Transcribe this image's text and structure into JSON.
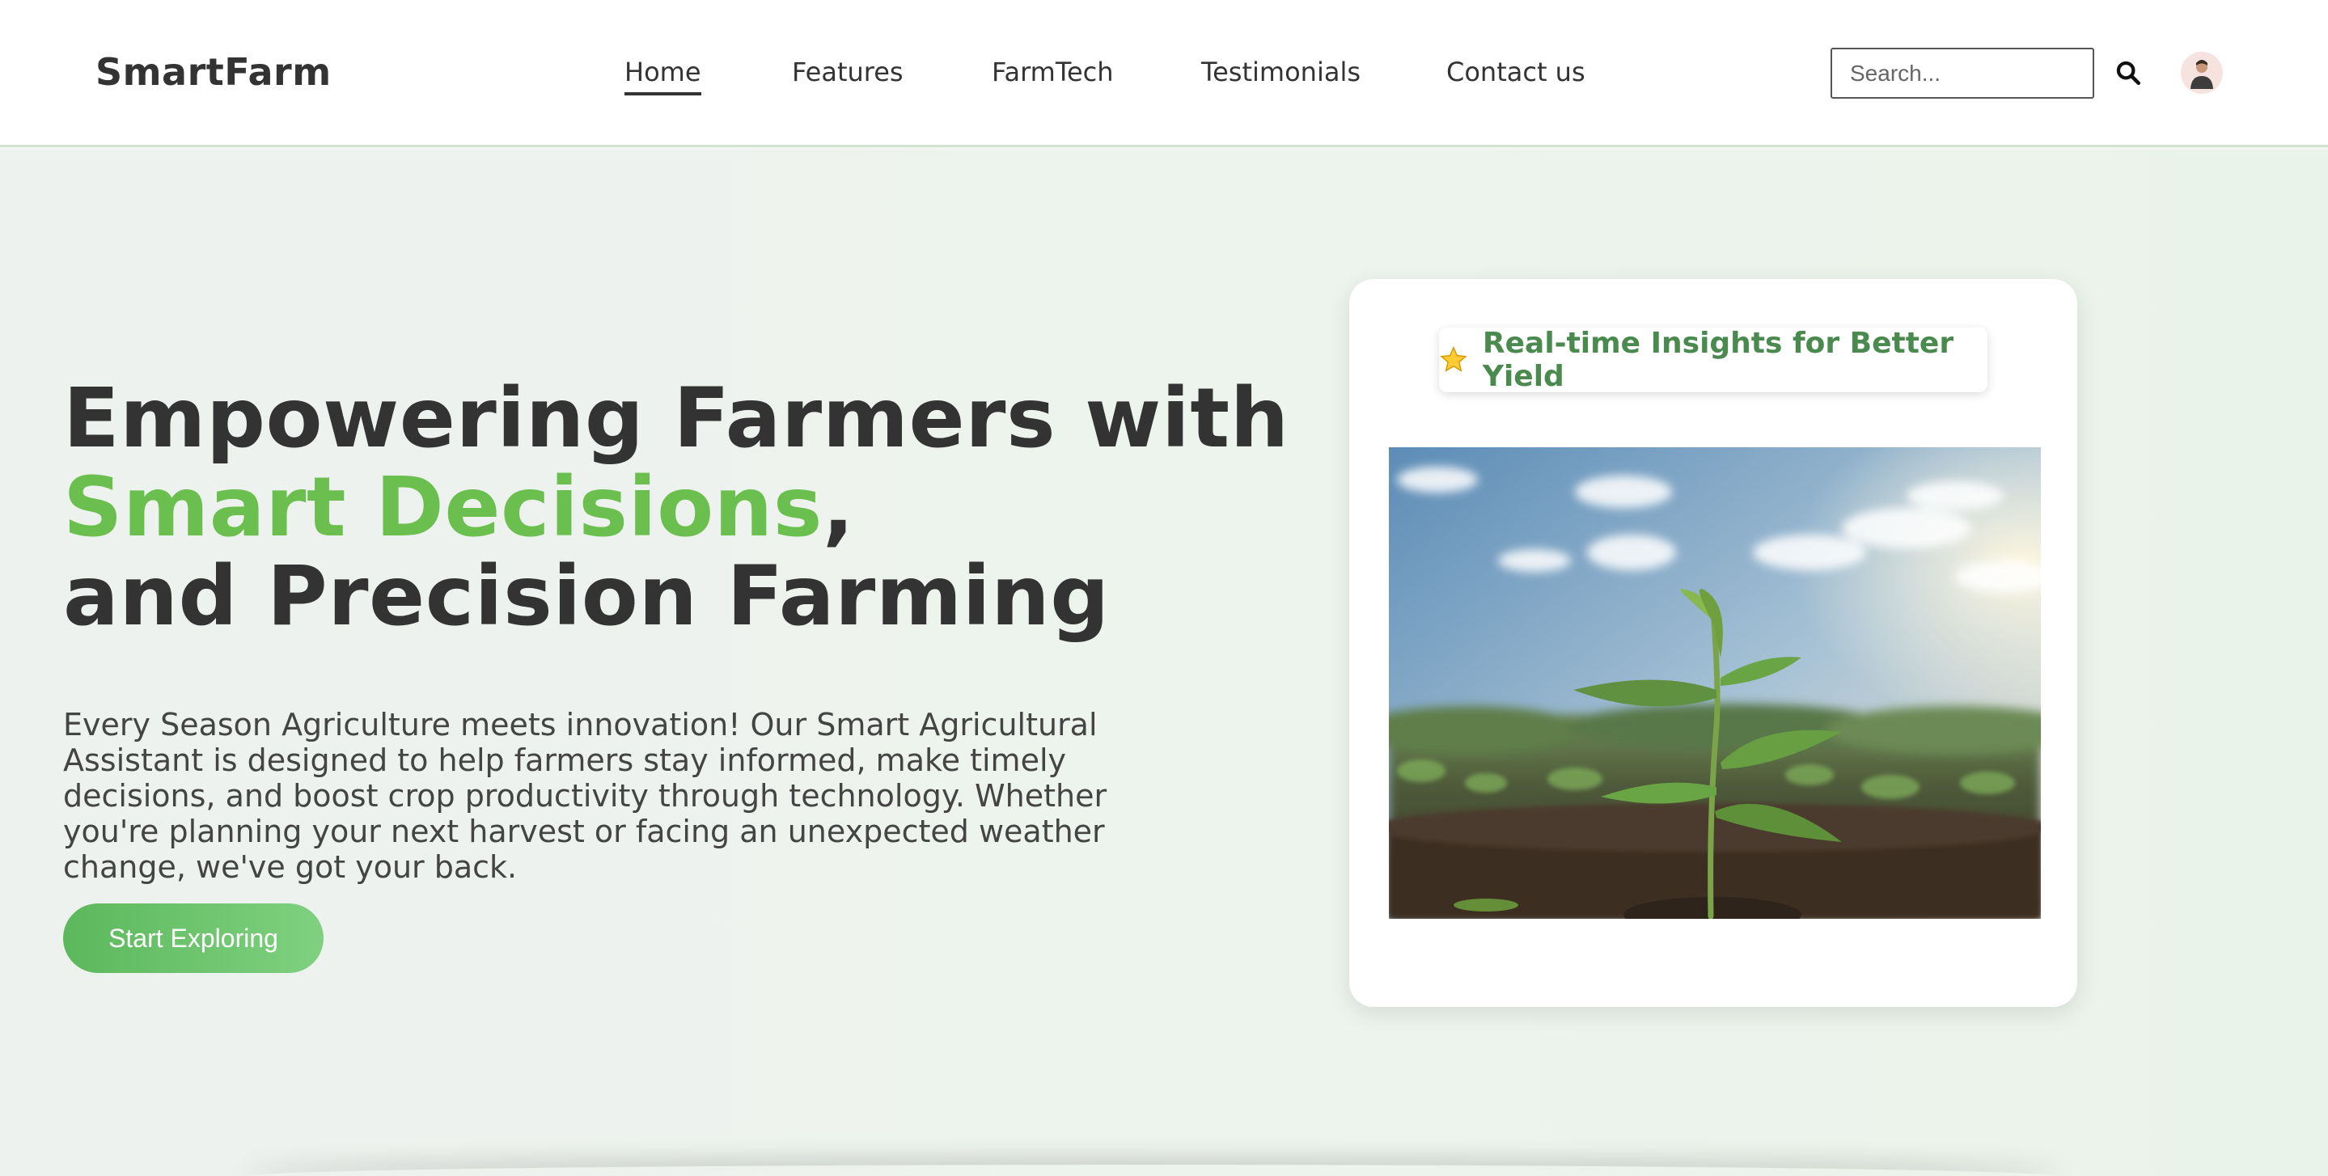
{
  "header": {
    "logo": "SmartFarm",
    "nav": [
      {
        "label": "Home",
        "active": true
      },
      {
        "label": "Features",
        "active": false
      },
      {
        "label": "FarmTech",
        "active": false
      },
      {
        "label": "Testimonials",
        "active": false
      },
      {
        "label": "Contact us",
        "active": false
      }
    ],
    "search": {
      "placeholder": "Search...",
      "value": ""
    },
    "icons": {
      "search": "search-icon",
      "avatar": "user-avatar-icon"
    }
  },
  "hero": {
    "headline_line1": "Empowering Farmers with",
    "headline_highlight": "Smart Decisions",
    "headline_comma": ",",
    "headline_line3": "and Precision Farming",
    "description": "Every Season Agriculture meets innovation! Our Smart Agricultural Assistant is designed to help farmers stay informed, make timely decisions, and boost crop productivity through technology. Whether you're planning your next harvest or facing an unexpected weather change, we've got your back.",
    "cta_label": "Start Exploring"
  },
  "card": {
    "badge_icon": "star-icon",
    "badge_text": "Real-time Insights for Better Yield",
    "image_subject": "young plant seedling in field"
  },
  "colors": {
    "accent_green": "#6bbf4e",
    "badge_green": "#4a8a4e",
    "button_start": "#5cb85c",
    "button_end": "#7fd17f",
    "text_dark": "#333333"
  }
}
